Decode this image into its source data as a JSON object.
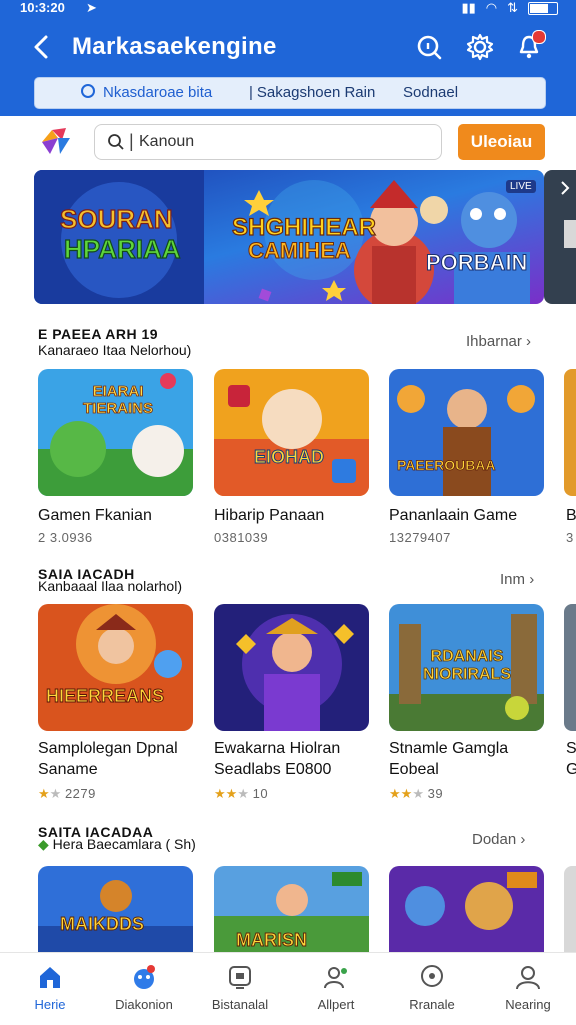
{
  "status": {
    "time": "10:3:20"
  },
  "header": {
    "title": "Markasaekengine",
    "tabs": [
      "Nkasdaroae bita",
      "Sakagshoen Rain",
      "Sodnael"
    ]
  },
  "search": {
    "value": "Kanoun",
    "button_label": "Uleoiau"
  },
  "banner": {
    "left_text_1": "SOURAN",
    "left_text_2": "HPARIAA",
    "center_text_1": "SHGHIHEAR",
    "center_text_2": "CAMIHEA",
    "right_text": "PORBAIN",
    "corner_tag": "LIVE"
  },
  "sections": [
    {
      "small": "E PAEEA ARH 19",
      "title": "Kanaraeo Itaa Nelorhou)",
      "see_all": "Ihbarnar",
      "cards": [
        {
          "title": "Gamen Fkanian",
          "meta": "2 3.0936",
          "img_text": "EIARAI TIERAINS"
        },
        {
          "title": "Hibarip Panaan",
          "meta": "0381039",
          "img_text": "EIOHAD"
        },
        {
          "title": "Pananlaain Game",
          "meta": "13279407",
          "img_text": "PAEEROUBAA"
        },
        {
          "title": "B",
          "meta": "3"
        }
      ]
    },
    {
      "small": "SAIA IACADH",
      "title": "Kanbaaal Ilaa nolarhol)",
      "see_all": "Inm",
      "cards": [
        {
          "title": "Samplolegan Dpnal Saname",
          "rating": "2279",
          "stars": 1,
          "img_text": "HIEERREANS"
        },
        {
          "title": "Ewakarna Hiolran Seadlabs E0800",
          "rating": "10",
          "stars": 3,
          "img_text": ""
        },
        {
          "title": "Stnamle Gamgla Eobeal",
          "rating": "39",
          "stars": 2,
          "img_text": "RDANAIS NIORIRALS"
        },
        {
          "title": "S G",
          "rating": ""
        }
      ]
    },
    {
      "small": "SAITA IACADAA",
      "title": "Hera Baecamlara ( Sh)",
      "see_all": "Dodan",
      "cards": [
        {
          "title": "",
          "img_text": "MAIKDDS"
        },
        {
          "title": "",
          "img_text": "MARISN"
        },
        {
          "title": "",
          "img_text": ""
        }
      ]
    }
  ],
  "nav": [
    {
      "label": "Herie",
      "icon": "home-icon"
    },
    {
      "label": "Diakonion",
      "icon": "game-icon"
    },
    {
      "label": "Bistanalal",
      "icon": "media-icon"
    },
    {
      "label": "Allpert",
      "icon": "people-icon"
    },
    {
      "label": "Rranale",
      "icon": "chat-icon"
    },
    {
      "label": "Nearing",
      "icon": "profile-icon"
    }
  ],
  "colors": {
    "primary": "#1f66d8",
    "accent": "#f08a1c",
    "star": "#e4a11b"
  }
}
